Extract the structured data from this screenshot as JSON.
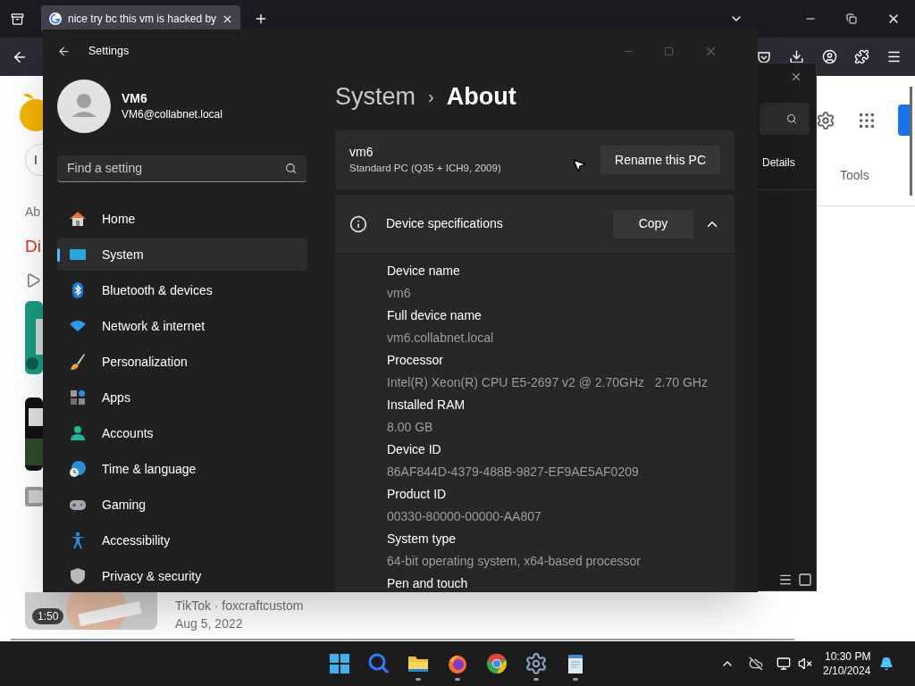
{
  "browser": {
    "tab": {
      "title": "nice try bc this vm is hacked by"
    },
    "left_fragments": [
      "I",
      "Ab",
      "Di"
    ],
    "video": {
      "duration": "1:50",
      "source": "TikTok · foxcraftcustom",
      "date": "Aug 5, 2022"
    },
    "right_fragments": {
      "tools": "Tools"
    }
  },
  "back_window": {
    "tab": "Details"
  },
  "settings": {
    "title": "Settings",
    "user": {
      "name": "VM6",
      "email": "VM6@collabnet.local"
    },
    "search": {
      "placeholder": "Find a setting"
    },
    "nav": [
      {
        "label": "Home",
        "kind": "home",
        "selected": false
      },
      {
        "label": "System",
        "kind": "system",
        "selected": true
      },
      {
        "label": "Bluetooth & devices",
        "kind": "bluetooth",
        "selected": false
      },
      {
        "label": "Network & internet",
        "kind": "network",
        "selected": false
      },
      {
        "label": "Personalization",
        "kind": "brush",
        "selected": false
      },
      {
        "label": "Apps",
        "kind": "apps",
        "selected": false
      },
      {
        "label": "Accounts",
        "kind": "accounts",
        "selected": false
      },
      {
        "label": "Time & language",
        "kind": "time",
        "selected": false
      },
      {
        "label": "Gaming",
        "kind": "gaming",
        "selected": false
      },
      {
        "label": "Accessibility",
        "kind": "accessibility",
        "selected": false
      },
      {
        "label": "Privacy & security",
        "kind": "privacy",
        "selected": false
      }
    ],
    "breadcrumb": {
      "parent": "System",
      "separator": "›",
      "current": "About"
    },
    "pc": {
      "name": "vm6",
      "model": "Standard PC (Q35 + ICH9, 2009)",
      "rename_button": "Rename this PC"
    },
    "specs": {
      "title": "Device specifications",
      "copy_button": "Copy",
      "expanded": true,
      "items": [
        {
          "label": "Device name",
          "value": "vm6"
        },
        {
          "label": "Full device name",
          "value": "vm6.collabnet.local"
        },
        {
          "label": "Processor",
          "value": "Intel(R) Xeon(R) CPU E5-2697 v2 @ 2.70GHz   2.70 GHz"
        },
        {
          "label": "Installed RAM",
          "value": "8.00 GB"
        },
        {
          "label": "Device ID",
          "value": "86AF844D-4379-488B-9827-EF9AE5AF0209"
        },
        {
          "label": "Product ID",
          "value": "00330-80000-00000-AA807"
        },
        {
          "label": "System type",
          "value": "64-bit operating system, x64-based processor"
        },
        {
          "label": "Pen and touch"
        }
      ]
    }
  },
  "taskbar": {
    "apps": [
      {
        "kind": "start",
        "running": false
      },
      {
        "kind": "search",
        "running": false
      },
      {
        "kind": "explorer",
        "running": true
      },
      {
        "kind": "firefox",
        "running": true
      },
      {
        "kind": "chrome",
        "running": false
      },
      {
        "kind": "settings",
        "running": true
      },
      {
        "kind": "notepad",
        "running": true
      }
    ],
    "time": "10:30 PM",
    "date": "2/10/2024"
  }
}
